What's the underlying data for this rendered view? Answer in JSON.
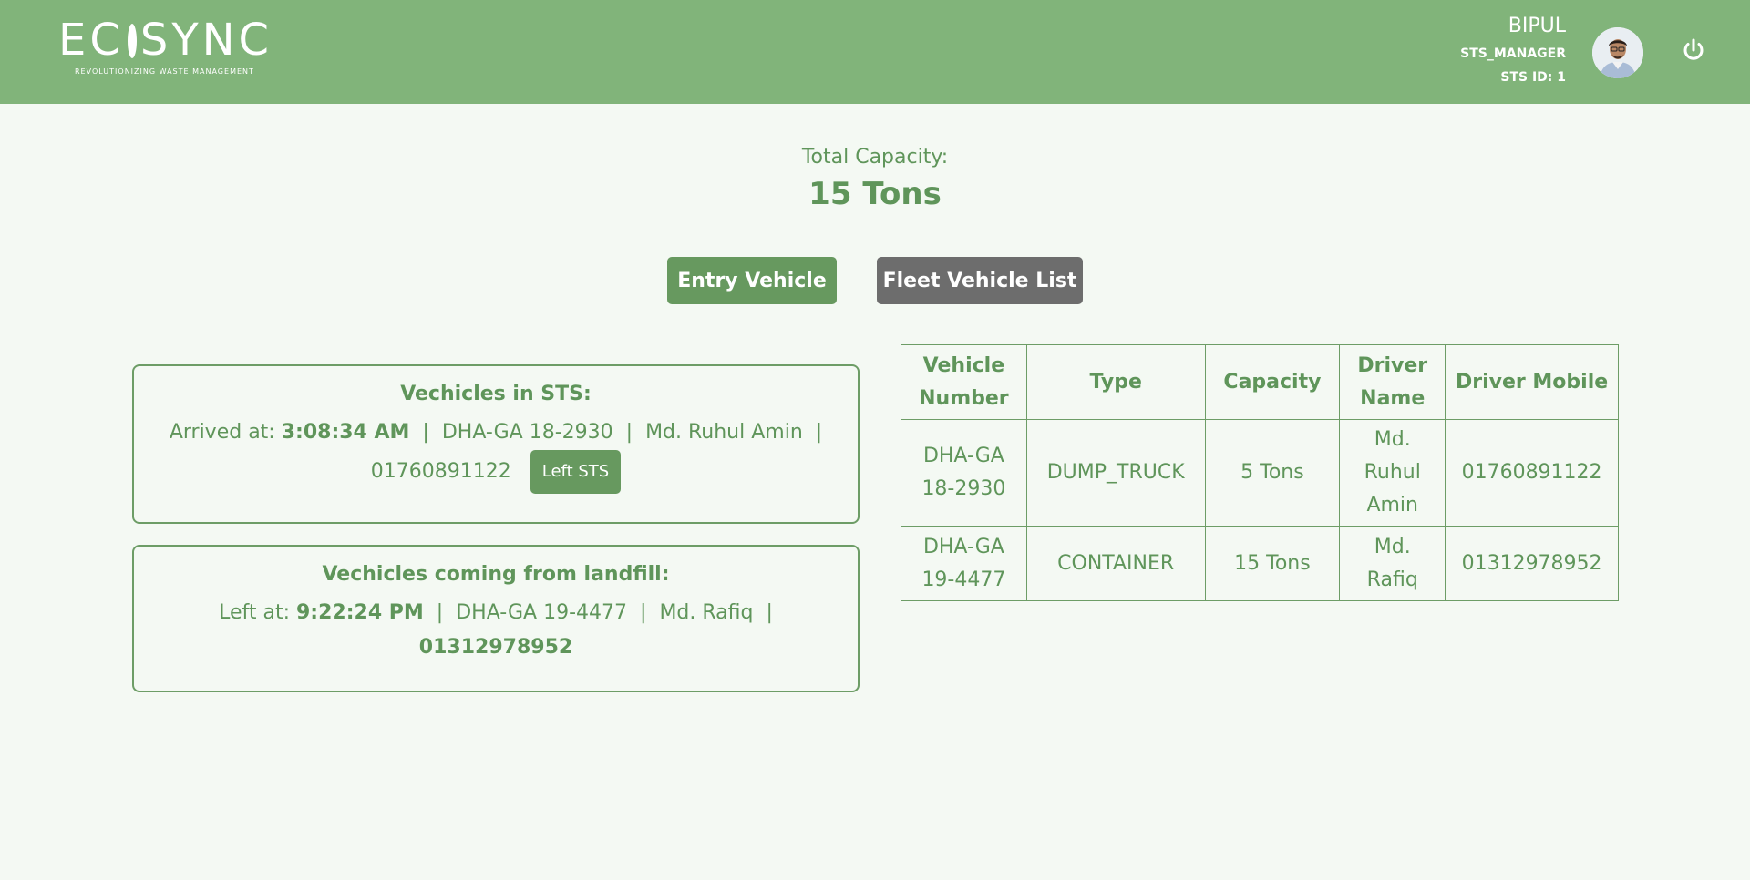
{
  "header": {
    "logo_text": "ECOSYNC",
    "tagline": "REVOLUTIONIZING WASTE MANAGEMENT",
    "user_name": "BIPUL",
    "user_role": "STS_MANAGER",
    "sts_id": "STS ID: 1",
    "avatar_icon": "avatar",
    "power_icon": "power-icon"
  },
  "capacity": {
    "label": "Total Capacity:",
    "value": "15 Tons"
  },
  "actions": {
    "entry_vehicle": "Entry Vehicle",
    "fleet_vehicle_list": "Fleet Vehicle List"
  },
  "in_sts": {
    "title": "Vechicles in STS:",
    "arrived_label": "Arrived at:",
    "arrived_time": "3:08:34 AM",
    "vehicle_number": "DHA-GA 18-2930",
    "driver_name": "Md. Ruhul Amin",
    "driver_mobile": "01760891122",
    "left_button": "Left STS"
  },
  "from_landfill": {
    "title": "Vechicles coming from landfill:",
    "left_label": "Left at:",
    "left_time": "9:22:24 PM",
    "vehicle_number": "DHA-GA 19-4477",
    "driver_name": "Md. Rafiq",
    "driver_mobile": "01312978952"
  },
  "table": {
    "headers": [
      "Vehicle Number",
      "Type",
      "Capacity",
      "Driver Name",
      "Driver Mobile"
    ],
    "rows": [
      [
        "DHA-GA 18-2930",
        "DUMP_TRUCK",
        "5 Tons",
        "Md. Ruhul Amin",
        "01760891122"
      ],
      [
        "DHA-GA 19-4477",
        "CONTAINER",
        "15 Tons",
        "Md. Rafiq",
        "01312978952"
      ]
    ]
  },
  "colors": {
    "header_bg": "#81b47a",
    "primary_green": "#67995f",
    "text_green": "#5f955a",
    "gray_button": "#6d6d6d",
    "page_bg": "#f4f9f3"
  }
}
